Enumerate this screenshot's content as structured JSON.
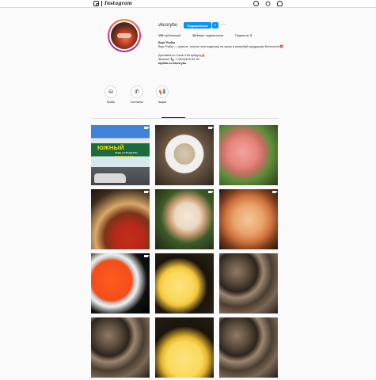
{
  "header": {
    "logo_text": "Instagram",
    "icons": [
      "explore-icon",
      "heart-icon",
      "profile-icon"
    ]
  },
  "profile": {
    "username": "vkusrybu",
    "subscribe_label": "Подписаться",
    "more_label": "···",
    "stats": {
      "posts_count": "153",
      "posts_label": "публикаций",
      "followers_count": "18,1тыс.",
      "followers_label": "подписчиков",
      "following_label": "Подписки:",
      "following_count": "3"
    },
    "bio": {
      "name": "Вкус Рыбы",
      "line1": "Вкус Рыбы — пряное, плохое чем подписку на заказ и попробуй продукцию бесплатно🎁",
      "line2": "Доставка по Санкт-Петербургу🚚",
      "phone": "Звоните 📞 +7(812)409-92-90",
      "link": "taplink.cc/vkusrybu"
    }
  },
  "highlights": [
    {
      "label": "Прайс",
      "icon": "coins-icon"
    },
    {
      "label": "Контакты",
      "icon": "whatsapp-icon"
    },
    {
      "label": "Акции",
      "icon": "megaphone-icon"
    }
  ],
  "posts": [
    {
      "name": "post-shop-front",
      "style": "t-shop",
      "video": true,
      "sign": "ЮЖНЫЙ",
      "sign_sub": "РЫБА И ПРОДУКТЫ",
      "sign_sub2": "ПИВКО И КОФЕ"
    },
    {
      "name": "post-plate",
      "style": "t-plate",
      "video": true
    },
    {
      "name": "post-salmon",
      "style": "t-salmon",
      "video": false
    },
    {
      "name": "post-fish-tomato",
      "style": "t-fish1",
      "video": true
    },
    {
      "name": "post-fish-slices",
      "style": "t-fish2",
      "video": true
    },
    {
      "name": "post-pizza",
      "style": "t-pizza",
      "video": true
    },
    {
      "name": "post-caviar",
      "style": "t-caviar",
      "video": true
    },
    {
      "name": "post-lemon-clams",
      "style": "t-lemon",
      "video": false
    },
    {
      "name": "post-clams",
      "style": "t-clams",
      "video": false
    },
    {
      "name": "post-clams-2",
      "style": "t-clams",
      "video": false
    },
    {
      "name": "post-lemon",
      "style": "t-lemon2",
      "video": false
    },
    {
      "name": "post-clams-3",
      "style": "t-clams",
      "video": false
    }
  ]
}
